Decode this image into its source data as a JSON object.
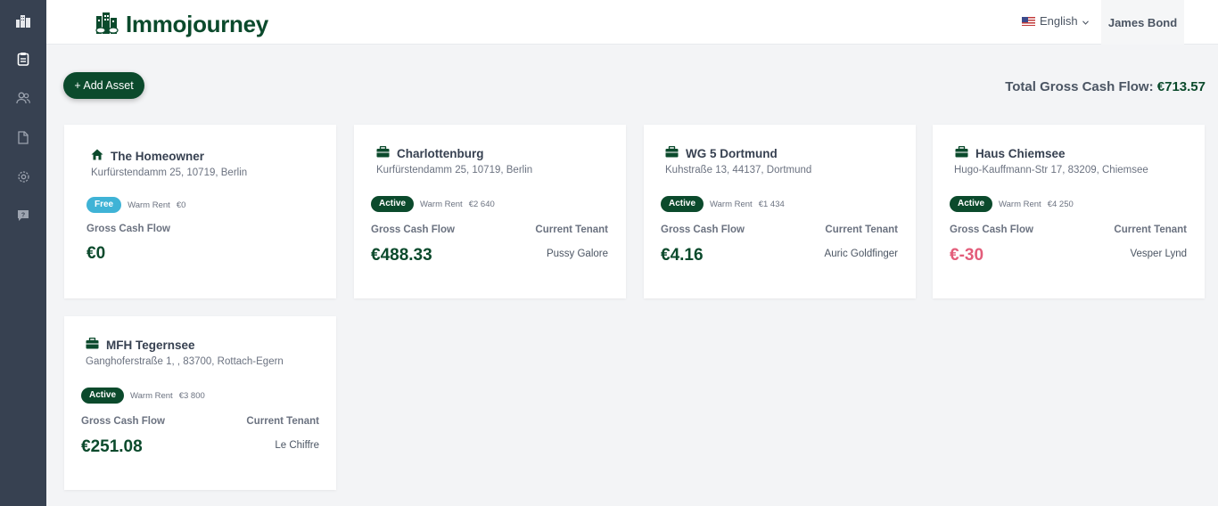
{
  "app": {
    "name": "Immojourney"
  },
  "header": {
    "language": "English",
    "user_name": "James Bond"
  },
  "toolbar": {
    "add_asset_label": "+ Add Asset",
    "total_label": "Total Gross Cash Flow:",
    "total_value": "€713.57"
  },
  "sidebar": {
    "items": [
      "clipboard-icon",
      "users-icon",
      "document-icon",
      "gear-icon",
      "chat-icon"
    ]
  },
  "colors": {
    "brand": "#0b4a2c",
    "sidebar": "#374151",
    "free_badge": "#3fb3d6",
    "negative": "#e35d7a"
  },
  "assets": [
    {
      "name": "The Homeowner",
      "icon": "house-icon",
      "address": "Kurfürstendamm 25, 10719, Berlin",
      "status": "Free",
      "warm_rent_label": "Warm Rent",
      "warm_rent": "€0",
      "cash_flow_label": "Gross Cash Flow",
      "cash_flow": "€0",
      "tenant_label": "",
      "tenant": ""
    },
    {
      "name": "Charlottenburg",
      "icon": "briefcase-icon",
      "address": "Kurfürstendamm 25, 10719, Berlin",
      "status": "Active",
      "warm_rent_label": "Warm Rent",
      "warm_rent": "€2 640",
      "cash_flow_label": "Gross Cash Flow",
      "cash_flow": "€488.33",
      "tenant_label": "Current Tenant",
      "tenant": "Pussy Galore"
    },
    {
      "name": "WG 5 Dortmund",
      "icon": "briefcase-icon",
      "address": "Kuhstraße 13, 44137, Dortmund",
      "status": "Active",
      "warm_rent_label": "Warm Rent",
      "warm_rent": "€1 434",
      "cash_flow_label": "Gross Cash Flow",
      "cash_flow": "€4.16",
      "tenant_label": "Current Tenant",
      "tenant": "Auric Goldfinger"
    },
    {
      "name": "Haus Chiemsee",
      "icon": "briefcase-icon",
      "address": "Hugo-Kauffmann-Str 17, 83209, Chiemsee",
      "status": "Active",
      "warm_rent_label": "Warm Rent",
      "warm_rent": "€4 250",
      "cash_flow_label": "Gross Cash Flow",
      "cash_flow": "€-30",
      "tenant_label": "Current Tenant",
      "tenant": "Vesper Lynd"
    },
    {
      "name": "MFH Tegernsee",
      "icon": "briefcase-icon",
      "address": "Ganghoferstraße 1, , 83700, Rottach-Egern",
      "status": "Active",
      "warm_rent_label": "Warm Rent",
      "warm_rent": "€3 800",
      "cash_flow_label": "Gross Cash Flow",
      "cash_flow": "€251.08",
      "tenant_label": "Current Tenant",
      "tenant": "Le Chiffre"
    }
  ]
}
